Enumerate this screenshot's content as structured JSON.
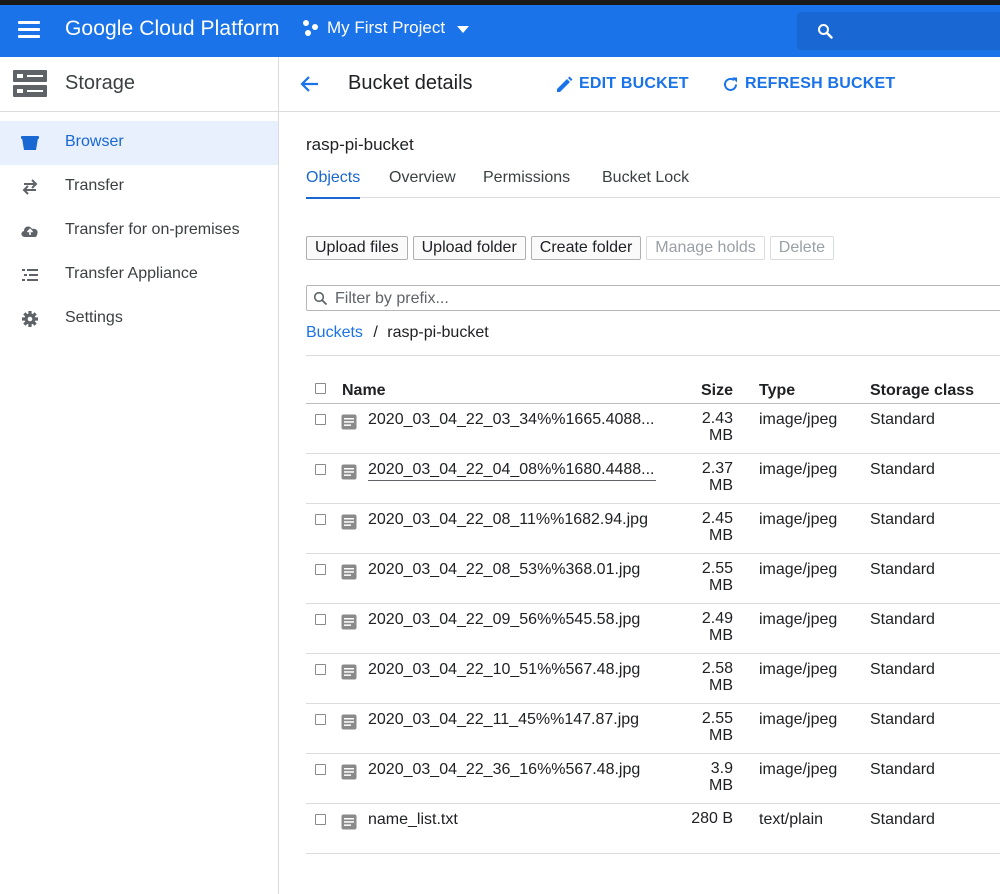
{
  "header": {
    "brand": "Google Cloud Platform",
    "project": "My First Project",
    "colors": {
      "bar": "#1a73e8",
      "search": "#1967d2"
    }
  },
  "sidebar": {
    "title": "Storage",
    "items": [
      {
        "label": "Browser",
        "icon": "bucket-icon",
        "active": true
      },
      {
        "label": "Transfer",
        "icon": "swap-arrows-icon"
      },
      {
        "label": "Transfer for on-premises",
        "icon": "cloud-upload-icon"
      },
      {
        "label": "Transfer Appliance",
        "icon": "list-icon"
      },
      {
        "label": "Settings",
        "icon": "gear-icon"
      }
    ]
  },
  "toolbar": {
    "title": "Bucket details",
    "edit_label": "EDIT BUCKET",
    "refresh_label": "REFRESH BUCKET"
  },
  "bucket": {
    "name": "rasp-pi-bucket",
    "tabs": [
      "Objects",
      "Overview",
      "Permissions",
      "Bucket Lock"
    ],
    "active_tab": "Objects"
  },
  "actions": {
    "upload_files": "Upload files",
    "upload_folder": "Upload folder",
    "create_folder": "Create folder",
    "manage_holds": "Manage holds",
    "delete": "Delete"
  },
  "filter": {
    "placeholder": "Filter by prefix..."
  },
  "breadcrumb": {
    "root": "Buckets",
    "separator": "/",
    "current": "rasp-pi-bucket"
  },
  "table": {
    "columns": {
      "name": "Name",
      "size": "Size",
      "type": "Type",
      "storage_class": "Storage class"
    },
    "rows": [
      {
        "name": "2020_03_04_22_03_34%%1665.4088...",
        "size_num": "2.43",
        "size_unit": "MB",
        "type": "image/jpeg",
        "storage_class": "Standard"
      },
      {
        "name": "2020_03_04_22_04_08%%1680.4488...",
        "size_num": "2.37",
        "size_unit": "MB",
        "type": "image/jpeg",
        "storage_class": "Standard"
      },
      {
        "name": "2020_03_04_22_08_11%%1682.94.jpg",
        "size_num": "2.45",
        "size_unit": "MB",
        "type": "image/jpeg",
        "storage_class": "Standard"
      },
      {
        "name": "2020_03_04_22_08_53%%368.01.jpg",
        "size_num": "2.55",
        "size_unit": "MB",
        "type": "image/jpeg",
        "storage_class": "Standard"
      },
      {
        "name": "2020_03_04_22_09_56%%545.58.jpg",
        "size_num": "2.49",
        "size_unit": "MB",
        "type": "image/jpeg",
        "storage_class": "Standard"
      },
      {
        "name": "2020_03_04_22_10_51%%567.48.jpg",
        "size_num": "2.58",
        "size_unit": "MB",
        "type": "image/jpeg",
        "storage_class": "Standard"
      },
      {
        "name": "2020_03_04_22_11_45%%147.87.jpg",
        "size_num": "2.55",
        "size_unit": "MB",
        "type": "image/jpeg",
        "storage_class": "Standard"
      },
      {
        "name": "2020_03_04_22_36_16%%567.48.jpg",
        "size_num": "3.9",
        "size_unit": "MB",
        "type": "image/jpeg",
        "storage_class": "Standard"
      },
      {
        "name": "name_list.txt",
        "size_num": "280 B",
        "size_unit": "",
        "type": "text/plain",
        "storage_class": "Standard"
      }
    ]
  }
}
